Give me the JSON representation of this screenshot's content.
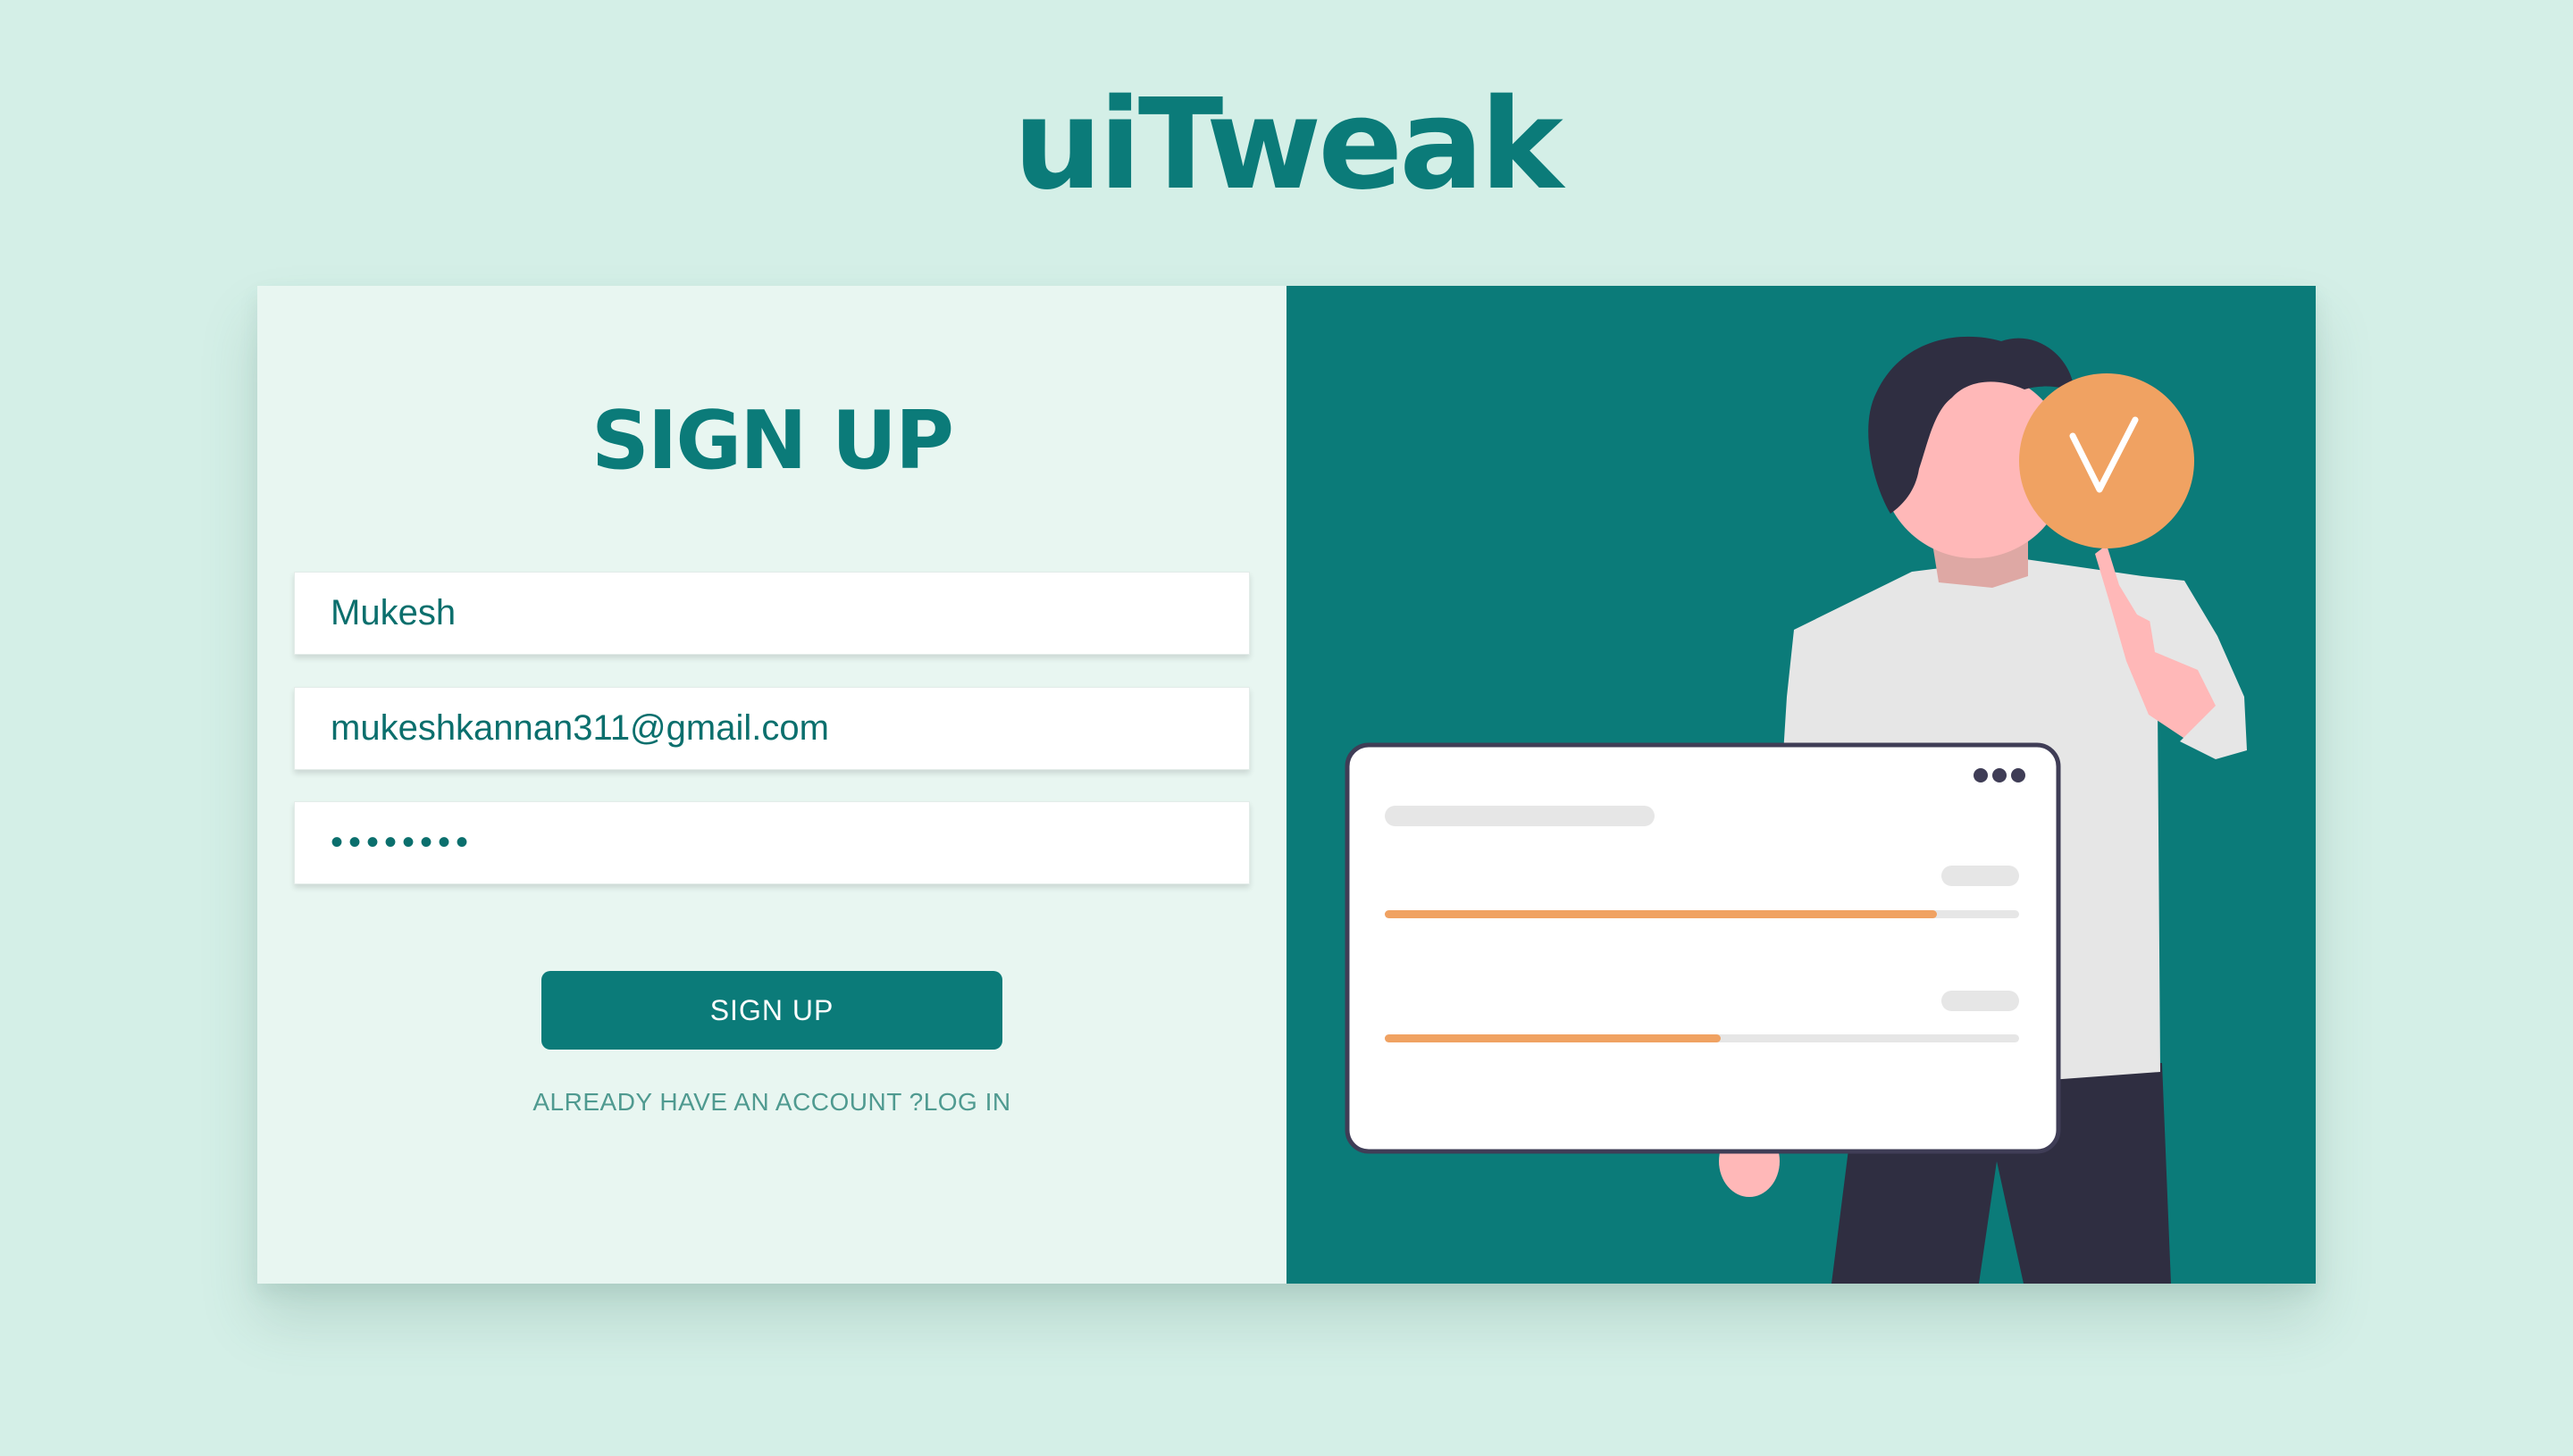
{
  "brand": {
    "title": "uiTweak"
  },
  "form": {
    "title": "SIGN UP",
    "name_value": "Mukesh",
    "email_value": "mukeshkannan311@gmail.com",
    "password_value": "••••••••",
    "submit_label": "SIGN UP",
    "login_link": "ALREADY HAVE AN ACCOUNT ?LOG IN"
  },
  "illustration": {
    "progress_bars": [
      {
        "fill": 0.87
      },
      {
        "fill": 0.53
      }
    ]
  },
  "colors": {
    "background": "#d4efe7",
    "accent": "#0b7b79",
    "form_panel": "#e8f6f1",
    "highlight": "#f0a262"
  },
  "icons": {
    "check": "check-badge-icon",
    "menu": "more-dots-icon"
  }
}
